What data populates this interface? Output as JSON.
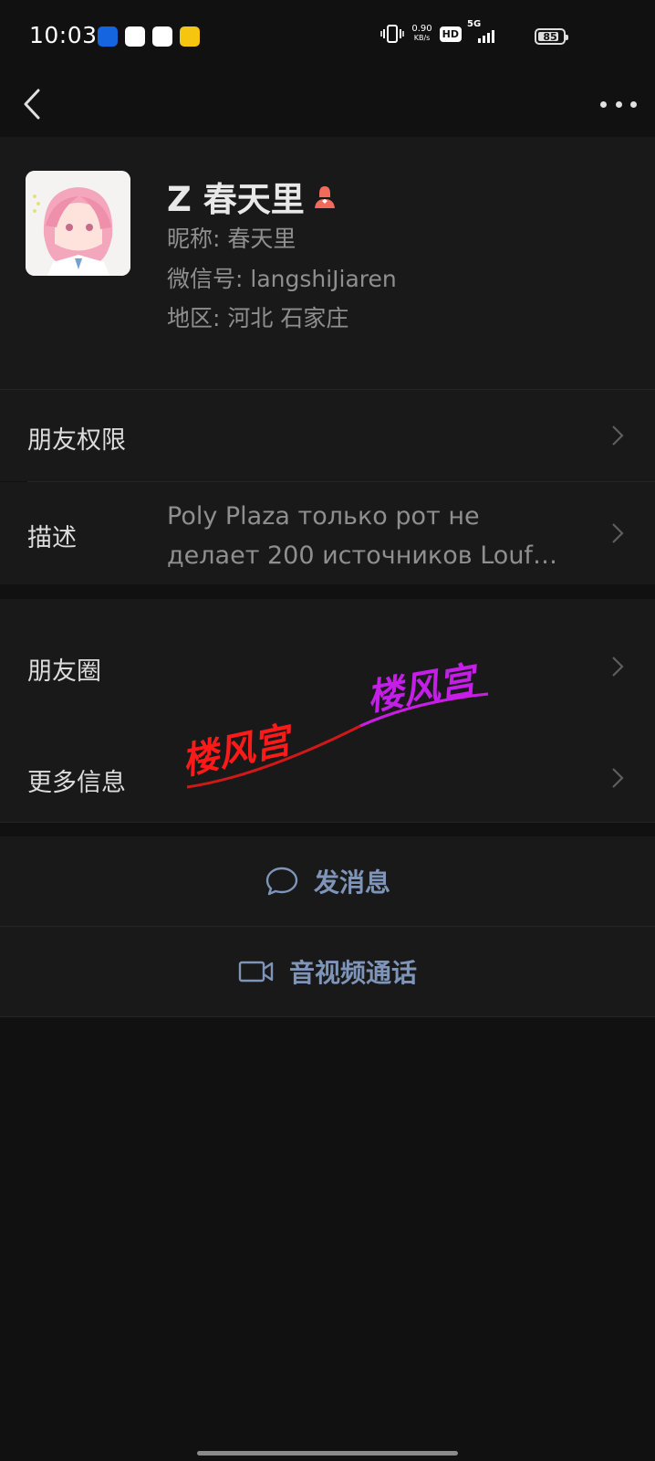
{
  "status_bar": {
    "time": "10:03",
    "net_speed_value": "0.90",
    "net_speed_unit": "KB/s",
    "hd": "HD",
    "network": "5G",
    "battery": "85",
    "battery_level": 0.85
  },
  "profile": {
    "name": "Z 春天里",
    "nickname": "昵称: 春天里",
    "wechat_id": "微信号: langshiJiaren",
    "region": "地区: 河北  石家庄"
  },
  "rows": {
    "permissions": "朋友权限",
    "description_label": "描述",
    "description_line1": "Poly Plaza только рот не",
    "description_line2": "делает 200 источников Louf…",
    "moments": "朋友圈",
    "more_info": "更多信息"
  },
  "actions": {
    "message": "发消息",
    "call": "音视频通话"
  },
  "watermark": {
    "text1": "楼风宫",
    "text2": "楼风宫"
  },
  "colors": {
    "background": "#111111",
    "card": "#191919",
    "action_text": "#7e95b9",
    "watermark_red": "#ff1a1a",
    "watermark_purple": "#c41ee8"
  }
}
